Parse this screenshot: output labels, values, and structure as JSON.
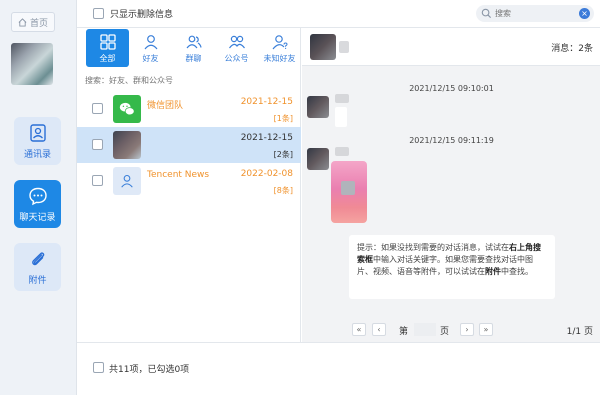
{
  "nav": {
    "home_label": "首页",
    "items": [
      {
        "label": "通讯录",
        "icon": "contacts-icon"
      },
      {
        "label": "聊天记录",
        "icon": "chat-bubble-icon"
      },
      {
        "label": "附件",
        "icon": "paperclip-icon"
      }
    ]
  },
  "topbar": {
    "show_deleted_label": "只显示删除信息",
    "search_placeholder": "搜索"
  },
  "categories": [
    {
      "label": "全部",
      "icon": "grid-icon"
    },
    {
      "label": "好友",
      "icon": "person-icon"
    },
    {
      "label": "群聊",
      "icon": "group-icon"
    },
    {
      "label": "公众号",
      "icon": "official-account-icon"
    },
    {
      "label": "未知好友",
      "icon": "unknown-person-icon"
    }
  ],
  "list_search_placeholder": "搜索：好友、群和公众号",
  "contacts": [
    {
      "name": "微信团队",
      "date": "2021-12-15",
      "count": "[1条]"
    },
    {
      "name": "",
      "date": "2021-12-15",
      "count": "[2条]"
    },
    {
      "name": "Tencent News",
      "date": "2022-02-08",
      "count": "[8条]"
    }
  ],
  "chat": {
    "message_count": "消息：2条",
    "timestamps": [
      "2021/12/15 09:10:01",
      "2021/12/15 09:11:19"
    ],
    "hint_prefix": "提示：如果没找到需要的对话消息，试试在",
    "hint_bold1": "右上角搜索框",
    "hint_mid": "中输入对话关键字。如果您需要查找对话中图片、视频、语音等附件，可以试试在",
    "hint_bold2": "附件",
    "hint_suffix": "中查找。",
    "pager": {
      "first": "«",
      "prev": "‹",
      "page_prefix": "第",
      "page_suffix": "页",
      "next": "›",
      "last": "»",
      "total": "1/1 页"
    }
  },
  "footer": {
    "summary": "共11项，已勾选0项"
  },
  "colors": {
    "accent": "#1e88e5",
    "orange": "#f0922c",
    "selected_row": "#cfe3f8"
  }
}
